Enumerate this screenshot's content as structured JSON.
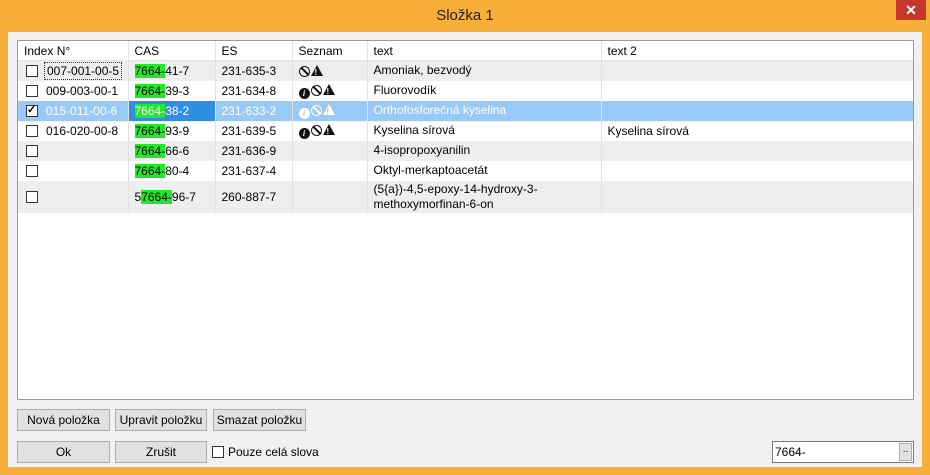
{
  "window": {
    "title": "Složka 1",
    "close_glyph": "✕"
  },
  "table": {
    "columns": [
      "Index N°",
      "CAS",
      "ES",
      "Seznam",
      "text",
      "text 2"
    ],
    "rows": [
      {
        "index": "007-001-00-5",
        "checked": false,
        "cas_pre": "",
        "cas_hl": "7664-",
        "cas_post": "41-7",
        "es": "231-635-3",
        "icons": [
          "ban-icon",
          "warning-icon"
        ],
        "text": "Amoniak, bezvodý",
        "text2": ""
      },
      {
        "index": "009-003-00-1",
        "checked": false,
        "cas_pre": "",
        "cas_hl": "7664-",
        "cas_post": "39-3",
        "es": "231-634-8",
        "icons": [
          "info-icon",
          "ban-icon",
          "warning-icon"
        ],
        "text": "Fluorovodík",
        "text2": ""
      },
      {
        "index": "015-011-00-6",
        "checked": true,
        "cas_pre": "",
        "cas_hl": "7664-",
        "cas_post": "38-2",
        "es": "231-633-2",
        "icons": [
          "info-icon",
          "ban-icon",
          "warning-icon"
        ],
        "text": "Orthofosforečná kyselina",
        "text2": ""
      },
      {
        "index": "016-020-00-8",
        "checked": false,
        "cas_pre": "",
        "cas_hl": "7664-",
        "cas_post": "93-9",
        "es": "231-639-5",
        "icons": [
          "info-icon",
          "ban-icon",
          "warning-icon"
        ],
        "text": "Kyselina sírová",
        "text2": "Kyselina sírová"
      },
      {
        "index": "",
        "checked": false,
        "cas_pre": "",
        "cas_hl": "7664-",
        "cas_post": "66-6",
        "es": "231-636-9",
        "icons": [],
        "text": "4-isopropoxyanilin",
        "text2": ""
      },
      {
        "index": "",
        "checked": false,
        "cas_pre": "",
        "cas_hl": "7664-",
        "cas_post": "80-4",
        "es": "231-637-4",
        "icons": [],
        "text": "Oktyl-merkaptoacetát",
        "text2": ""
      },
      {
        "index": "",
        "checked": false,
        "cas_pre": "5",
        "cas_hl": "7664-",
        "cas_post": "96-7",
        "es": "260-887-7",
        "icons": [],
        "text": "(5{a})-4,5-epoxy-14-hydroxy-3-methoxymorfinan-6-on",
        "text2": ""
      }
    ]
  },
  "buttons": {
    "new": "Nová položka",
    "edit": "Upravit položku",
    "delete": "Smazat položku",
    "ok": "Ok",
    "cancel": "Zrušit"
  },
  "whole_words": {
    "label": "Pouze celá slova",
    "checked": false
  },
  "search": {
    "value": "7664-",
    "button": ".."
  },
  "colors": {
    "title_bar": "#f7af3a",
    "selection": "#99c9f5",
    "selection_cell": "#2f8de4",
    "highlight": "#22e82a",
    "close": "#c7372f"
  }
}
